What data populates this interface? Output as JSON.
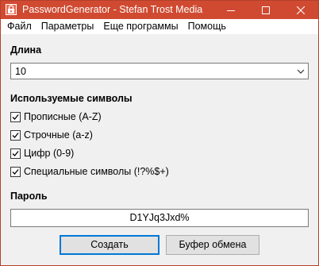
{
  "window": {
    "title": "PasswordGenerator - Stefan Trost Media",
    "accent_color": "#d04a31"
  },
  "menu": {
    "items": [
      "Файл",
      "Параметры",
      "Еще программы",
      "Помощь"
    ]
  },
  "length": {
    "label": "Длина",
    "value": "10"
  },
  "symbols": {
    "label": "Используемые символы",
    "options": [
      {
        "label": "Прописные (A-Z)",
        "checked": true
      },
      {
        "label": "Строчные (a-z)",
        "checked": true
      },
      {
        "label": "Цифр (0-9)",
        "checked": true
      },
      {
        "label": "Специальные символы (!?%$+)",
        "checked": true
      }
    ]
  },
  "password": {
    "label": "Пароль",
    "value": "D1YJq3Jxd%"
  },
  "buttons": {
    "create": "Создать",
    "clipboard": "Буфер обмена"
  },
  "icons": {
    "app": "app-icon",
    "minimize": "minimize-icon",
    "maximize": "maximize-icon",
    "close": "close-icon",
    "dropdown": "chevron-down-icon",
    "check": "checkmark-icon"
  }
}
